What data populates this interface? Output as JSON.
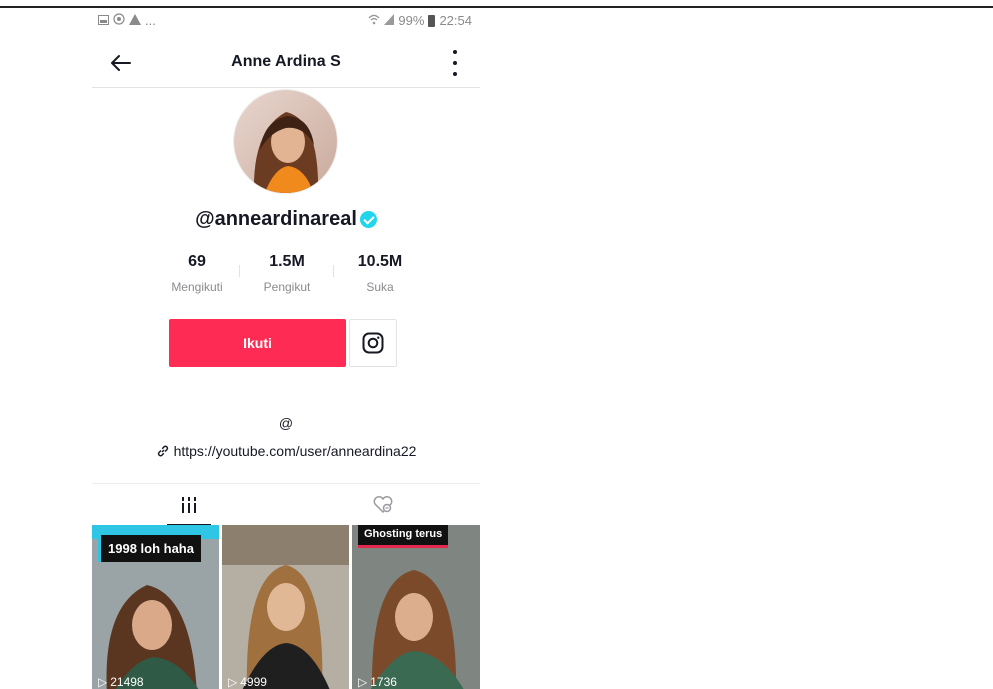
{
  "status_bar": {
    "left_icons": [
      "gallery-icon",
      "whatsapp-icon",
      "alert-icon"
    ],
    "ellipsis": "...",
    "battery": "99%",
    "time": "22:54"
  },
  "header": {
    "title": "Anne Ardina S"
  },
  "profile": {
    "username": "@anneardinareal",
    "verified": true,
    "stats": [
      {
        "value": "69",
        "label": "Mengikuti"
      },
      {
        "value": "1.5M",
        "label": "Pengikut"
      },
      {
        "value": "10.5M",
        "label": "Suka"
      }
    ],
    "follow_label": "Ikuti",
    "bio": "@",
    "link": "https://youtube.com/user/anneardina22"
  },
  "tabs": [
    {
      "icon": "videos-grid-icon",
      "active": true
    },
    {
      "icon": "liked-heart-icon",
      "active": false
    }
  ],
  "videos": [
    {
      "caption": "1998 loh haha",
      "plays": "21498"
    },
    {
      "caption": "",
      "plays": "4999"
    },
    {
      "caption": "Ghosting terus",
      "plays": "1736"
    }
  ],
  "colors": {
    "accent": "#fe2c55",
    "verified": "#20d5ec",
    "text": "#161823",
    "muted": "#8a8b91"
  }
}
